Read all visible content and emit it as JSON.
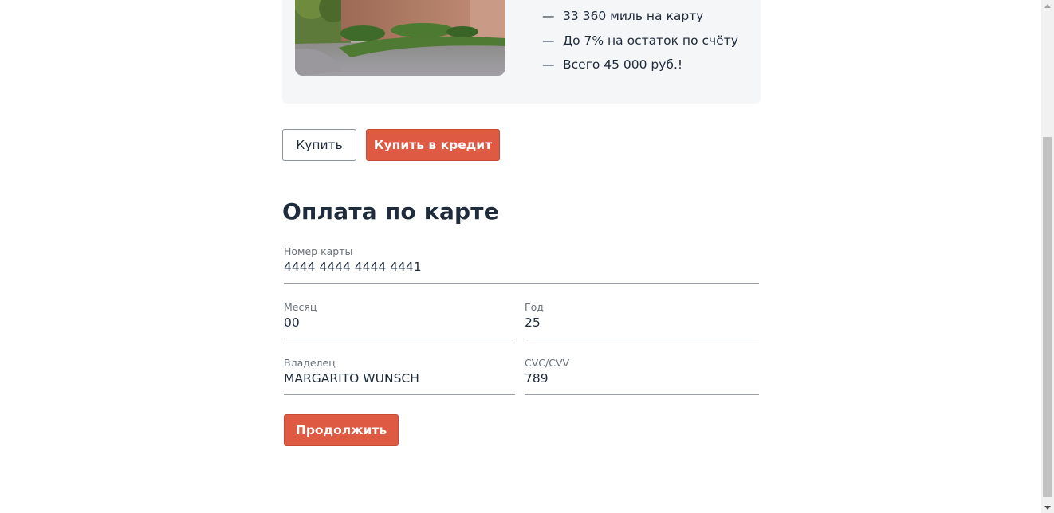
{
  "promo": {
    "image_alt": "Marrakech city wall",
    "features": [
      "33 360 миль на карту",
      "До 7% на остаток по счёту",
      "Всего 45 000 руб.!"
    ],
    "dash": "—"
  },
  "actions": {
    "buy_label": "Купить",
    "credit_label": "Купить в кредит"
  },
  "payment": {
    "title": "Оплата по карте",
    "card_number": {
      "label": "Номер карты",
      "value": "4444 4444 4444 4441"
    },
    "month": {
      "label": "Месяц",
      "value": "00"
    },
    "year": {
      "label": "Год",
      "value": "25"
    },
    "owner": {
      "label": "Владелец",
      "value": "MARGARITO WUNSCH"
    },
    "cvc": {
      "label": "CVC/CVV",
      "value": "789"
    },
    "continue_label": "Продолжить"
  },
  "colors": {
    "accent": "#de5a43",
    "text": "#1f2c3c",
    "card_bg": "#f5f6f8"
  }
}
